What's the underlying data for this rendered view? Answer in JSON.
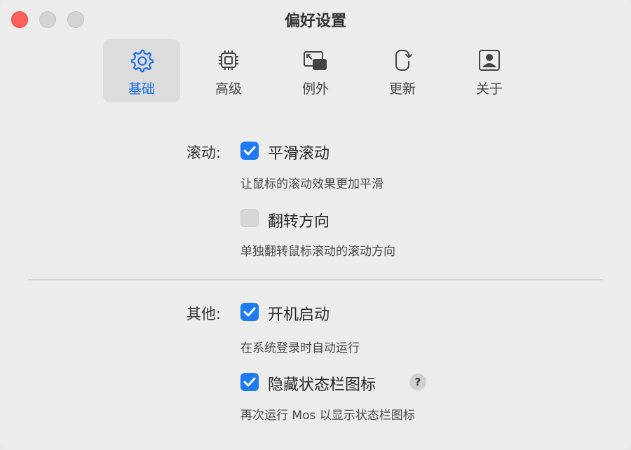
{
  "window": {
    "title": "偏好设置"
  },
  "tabs": [
    {
      "label": "基础",
      "icon": "gear-icon",
      "active": true
    },
    {
      "label": "高级",
      "icon": "cpu-icon",
      "active": false
    },
    {
      "label": "例外",
      "icon": "exception-window-icon",
      "active": false
    },
    {
      "label": "更新",
      "icon": "update-icon",
      "active": false
    },
    {
      "label": "关于",
      "icon": "person-icon",
      "active": false
    }
  ],
  "scroll": {
    "label": "滚动:",
    "smooth": {
      "label": "平滑滚动",
      "checked": true,
      "desc": "让鼠标的滚动效果更加平滑"
    },
    "reverse": {
      "label": "翻转方向",
      "checked": false,
      "desc": "单独翻转鼠标滚动的滚动方向"
    }
  },
  "other": {
    "label": "其他:",
    "launch": {
      "label": "开机启动",
      "checked": true,
      "desc": "在系统登录时自动运行"
    },
    "hide_icon": {
      "label": "隐藏状态栏图标",
      "checked": true,
      "desc": "再次运行 Mos 以显示状态栏图标",
      "help": "?"
    }
  },
  "colors": {
    "accent": "#1e7cf0",
    "close": "#fe5f57"
  }
}
